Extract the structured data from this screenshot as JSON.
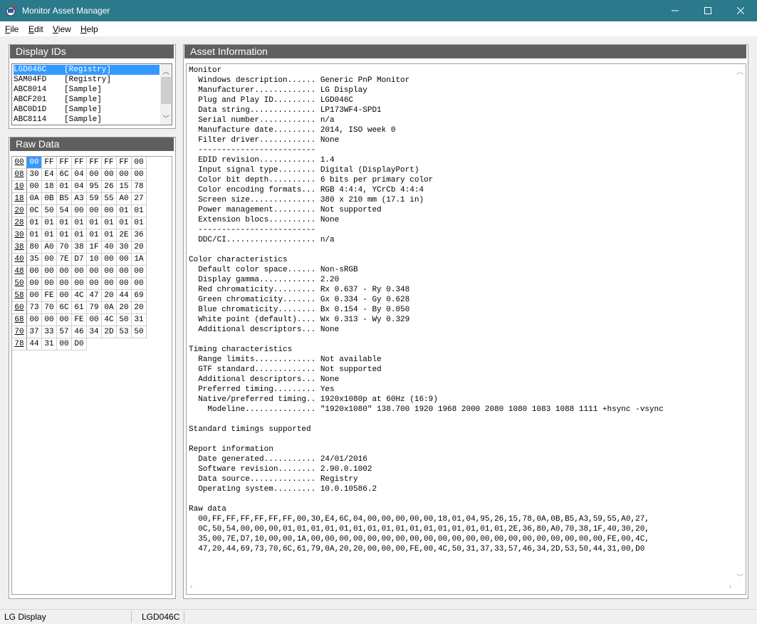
{
  "window": {
    "title": "Monitor Asset Manager"
  },
  "menu": [
    {
      "accel": "F",
      "rest": "ile"
    },
    {
      "accel": "E",
      "rest": "dit"
    },
    {
      "accel": "V",
      "rest": "iew"
    },
    {
      "accel": "H",
      "rest": "elp"
    }
  ],
  "display_ids": {
    "header": "Display IDs",
    "items": [
      {
        "id": "LGD046C",
        "source": "[Registry]",
        "selected": true
      },
      {
        "id": "SAM04FD",
        "source": "[Registry]",
        "selected": false
      },
      {
        "id": "ABC8014",
        "source": "[Sample]",
        "selected": false
      },
      {
        "id": "ABCF201",
        "source": "[Sample]",
        "selected": false
      },
      {
        "id": "ABC0D1D",
        "source": "[Sample]",
        "selected": false
      },
      {
        "id": "ABC8114",
        "source": "[Sample]",
        "selected": false
      }
    ]
  },
  "raw_data": {
    "header": "Raw Data",
    "bytes": "00,FF,FF,FF,FF,FF,FF,00,30,E4,6C,04,00,00,00,00,00,18,01,04,95,26,15,78,0A,0B,B5,A3,59,55,A0,27,0C,50,54,00,00,00,01,01,01,01,01,01,01,01,01,01,01,01,01,01,01,01,2E,36,80,A0,70,38,1F,40,30,20,35,00,7E,D7,10,00,00,1A,00,00,00,00,00,00,00,00,00,00,00,00,00,00,00,00,00,FE,00,4C,47,20,44,69,73,70,6C,61,79,0A,20,20,00,00,00,FE,00,4C,50,31,37,33,57,46,34,2D,53,50,44,31,00,D0"
  },
  "asset_info": {
    "header": "Asset Information",
    "lines": [
      "Monitor",
      "  Windows description...... Generic PnP Monitor",
      "  Manufacturer............. LG Display",
      "  Plug and Play ID......... LGD046C",
      "  Data string.............. LP173WF4-SPD1",
      "  Serial number............ n/a",
      "  Manufacture date......... 2014, ISO week 0",
      "  Filter driver............ None",
      "  -------------------------",
      "  EDID revision............ 1.4",
      "  Input signal type........ Digital (DisplayPort)",
      "  Color bit depth.......... 6 bits per primary color",
      "  Color encoding formats... RGB 4:4:4, YCrCb 4:4:4",
      "  Screen size.............. 380 x 210 mm (17.1 in)",
      "  Power management......... Not supported",
      "  Extension blocs.......... None",
      "  -------------------------",
      "  DDC/CI................... n/a",
      "",
      "Color characteristics",
      "  Default color space...... Non-sRGB",
      "  Display gamma............ 2.20",
      "  Red chromaticity......... Rx 0.637 - Ry 0.348",
      "  Green chromaticity....... Gx 0.334 - Gy 0.628",
      "  Blue chromaticity........ Bx 0.154 - By 0.050",
      "  White point (default).... Wx 0.313 - Wy 0.329",
      "  Additional descriptors... None",
      "",
      "Timing characteristics",
      "  Range limits............. Not available",
      "  GTF standard............. Not supported",
      "  Additional descriptors... None",
      "  Preferred timing......... Yes",
      "  Native/preferred timing.. 1920x1080p at 60Hz (16:9)",
      "    Modeline............... \"1920x1080\" 138.700 1920 1968 2000 2080 1080 1083 1088 1111 +hsync -vsync",
      "",
      "Standard timings supported",
      "",
      "Report information",
      "  Date generated........... 24/01/2016",
      "  Software revision........ 2.90.0.1002",
      "  Data source.............. Registry",
      "  Operating system......... 10.0.10586.2",
      "",
      "Raw data",
      "  00,FF,FF,FF,FF,FF,FF,00,30,E4,6C,04,00,00,00,00,00,18,01,04,95,26,15,78,0A,0B,B5,A3,59,55,A0,27,",
      "  0C,50,54,00,00,00,01,01,01,01,01,01,01,01,01,01,01,01,01,01,01,01,2E,36,80,A0,70,38,1F,40,30,20,",
      "  35,00,7E,D7,10,00,00,1A,00,00,00,00,00,00,00,00,00,00,00,00,00,00,00,00,00,00,00,00,00,FE,00,4C,",
      "  47,20,44,69,73,70,6C,61,79,0A,20,20,00,00,00,FE,00,4C,50,31,37,33,57,46,34,2D,53,50,44,31,00,D0"
    ]
  },
  "status": {
    "left": "LG Display",
    "right": "LGD046C"
  }
}
